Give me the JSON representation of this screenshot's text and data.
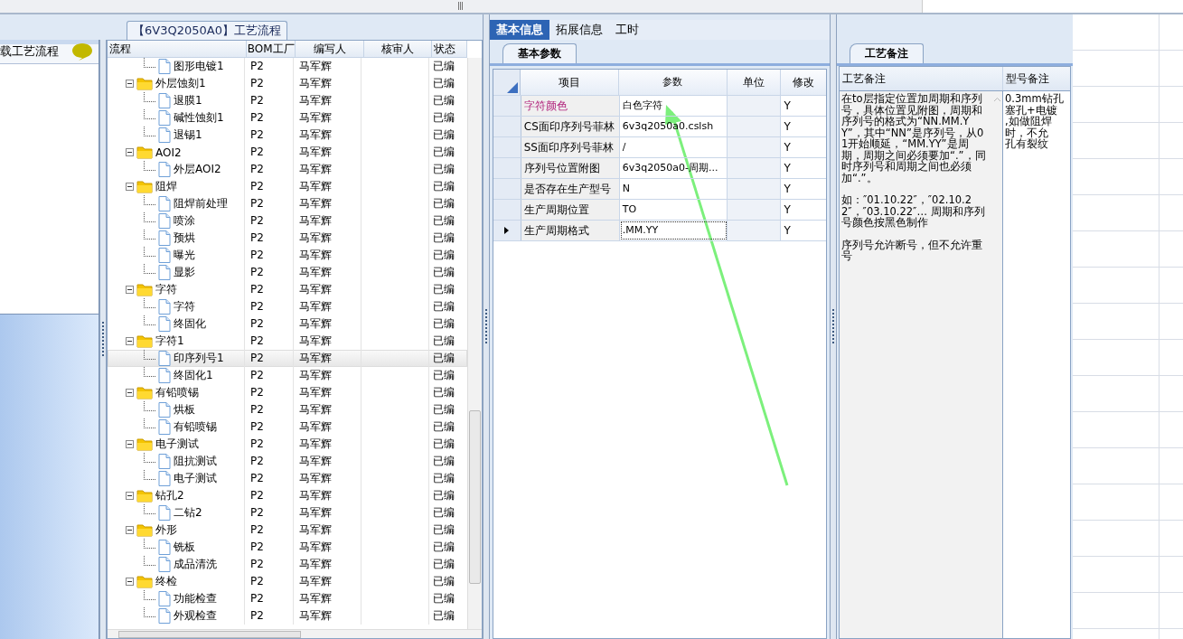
{
  "process_panel": {
    "title": "【6V3Q2050A0】工艺流程"
  },
  "sidebar": {
    "label": "载工艺流程"
  },
  "tree": {
    "columns": [
      "流程",
      "BOM工厂",
      "编写人",
      "核审人",
      "状态"
    ],
    "nodes": [
      {
        "kind": "file",
        "name": "图形电镀1",
        "bom": "P2",
        "author": "马军辉",
        "status": "已编",
        "selected": false
      },
      {
        "kind": "folder",
        "name": "外层蚀刻1",
        "bom": "P2",
        "author": "马军辉",
        "status": "已编",
        "selected": false,
        "children": [
          {
            "kind": "file",
            "name": "退膜1",
            "bom": "P2",
            "author": "马军辉",
            "status": "已编",
            "selected": false
          },
          {
            "kind": "file",
            "name": "碱性蚀刻1",
            "bom": "P2",
            "author": "马军辉",
            "status": "已编",
            "selected": false
          },
          {
            "kind": "file",
            "name": "退锡1",
            "bom": "P2",
            "author": "马军辉",
            "status": "已编",
            "selected": false
          }
        ]
      },
      {
        "kind": "folder",
        "name": "AOI2",
        "bom": "P2",
        "author": "马军辉",
        "status": "已编",
        "selected": false,
        "children": [
          {
            "kind": "file",
            "name": "外层AOI2",
            "bom": "P2",
            "author": "马军辉",
            "status": "已编",
            "selected": false
          }
        ]
      },
      {
        "kind": "folder",
        "name": "阻焊",
        "bom": "P2",
        "author": "马军辉",
        "status": "已编",
        "selected": false,
        "children": [
          {
            "kind": "file",
            "name": "阻焊前处理",
            "bom": "P2",
            "author": "马军辉",
            "status": "已编",
            "selected": false
          },
          {
            "kind": "file",
            "name": "喷涂",
            "bom": "P2",
            "author": "马军辉",
            "status": "已编",
            "selected": false
          },
          {
            "kind": "file",
            "name": "预烘",
            "bom": "P2",
            "author": "马军辉",
            "status": "已编",
            "selected": false
          },
          {
            "kind": "file",
            "name": "曝光",
            "bom": "P2",
            "author": "马军辉",
            "status": "已编",
            "selected": false
          },
          {
            "kind": "file",
            "name": "显影",
            "bom": "P2",
            "author": "马军辉",
            "status": "已编",
            "selected": false
          }
        ]
      },
      {
        "kind": "folder",
        "name": "字符",
        "bom": "P2",
        "author": "马军辉",
        "status": "已编",
        "selected": false,
        "children": [
          {
            "kind": "file",
            "name": "字符",
            "bom": "P2",
            "author": "马军辉",
            "status": "已编",
            "selected": false
          },
          {
            "kind": "file",
            "name": "终固化",
            "bom": "P2",
            "author": "马军辉",
            "status": "已编",
            "selected": false
          }
        ]
      },
      {
        "kind": "folder",
        "name": "字符1",
        "bom": "P2",
        "author": "马军辉",
        "status": "已编",
        "selected": false,
        "children": [
          {
            "kind": "file",
            "name": "印序列号1",
            "bom": "P2",
            "author": "马军辉",
            "status": "已编",
            "selected": true
          },
          {
            "kind": "file",
            "name": "终固化1",
            "bom": "P2",
            "author": "马军辉",
            "status": "已编",
            "selected": false
          }
        ]
      },
      {
        "kind": "folder",
        "name": "有铅喷锡",
        "bom": "P2",
        "author": "马军辉",
        "status": "已编",
        "selected": false,
        "children": [
          {
            "kind": "file",
            "name": "烘板",
            "bom": "P2",
            "author": "马军辉",
            "status": "已编",
            "selected": false
          },
          {
            "kind": "file",
            "name": "有铅喷锡",
            "bom": "P2",
            "author": "马军辉",
            "status": "已编",
            "selected": false
          }
        ]
      },
      {
        "kind": "folder",
        "name": "电子测试",
        "bom": "P2",
        "author": "马军辉",
        "status": "已编",
        "selected": false,
        "children": [
          {
            "kind": "file",
            "name": "阻抗测试",
            "bom": "P2",
            "author": "马军辉",
            "status": "已编",
            "selected": false
          },
          {
            "kind": "file",
            "name": "电子测试",
            "bom": "P2",
            "author": "马军辉",
            "status": "已编",
            "selected": false
          }
        ]
      },
      {
        "kind": "folder",
        "name": "钻孔2",
        "bom": "P2",
        "author": "马军辉",
        "status": "已编",
        "selected": false,
        "children": [
          {
            "kind": "file",
            "name": "二钻2",
            "bom": "P2",
            "author": "马军辉",
            "status": "已编",
            "selected": false
          }
        ]
      },
      {
        "kind": "folder",
        "name": "外形",
        "bom": "P2",
        "author": "马军辉",
        "status": "已编",
        "selected": false,
        "children": [
          {
            "kind": "file",
            "name": "铣板",
            "bom": "P2",
            "author": "马军辉",
            "status": "已编",
            "selected": false
          },
          {
            "kind": "file",
            "name": "成品清洗",
            "bom": "P2",
            "author": "马军辉",
            "status": "已编",
            "selected": false
          }
        ]
      },
      {
        "kind": "folder",
        "name": "终检",
        "bom": "P2",
        "author": "马军辉",
        "status": "已编",
        "selected": false,
        "children": [
          {
            "kind": "file",
            "name": "功能检查",
            "bom": "P2",
            "author": "马军辉",
            "status": "已编",
            "selected": false
          },
          {
            "kind": "file",
            "name": "外观检查",
            "bom": "P2",
            "author": "马军辉",
            "status": "已编",
            "selected": false
          }
        ]
      }
    ]
  },
  "tabs": [
    {
      "label": "基本信息",
      "selected": true
    },
    {
      "label": "拓展信息",
      "selected": false
    },
    {
      "label": "工时",
      "selected": false
    }
  ],
  "params": {
    "tab": "基本参数",
    "columns": [
      "项目",
      "参数",
      "单位",
      "修改"
    ],
    "rows": [
      {
        "item": "字符颜色",
        "value": "白色字符",
        "unit": "",
        "modify": "Y",
        "highlighted": true,
        "current": false
      },
      {
        "item": "CS面印序列号菲林",
        "value": "6v3q2050a0.cslsh",
        "unit": "",
        "modify": "Y",
        "highlighted": false,
        "current": false
      },
      {
        "item": "SS面印序列号菲林",
        "value": "/",
        "unit": "",
        "modify": "Y",
        "highlighted": false,
        "current": false
      },
      {
        "item": "序列号位置附图",
        "value": "6v3q2050a0-周期...",
        "unit": "",
        "modify": "Y",
        "highlighted": false,
        "current": false
      },
      {
        "item": "是否存在生产型号",
        "value": "N",
        "unit": "",
        "modify": "Y",
        "highlighted": false,
        "current": false
      },
      {
        "item": "生产周期位置",
        "value": "TO",
        "unit": "",
        "modify": "Y",
        "highlighted": false,
        "current": false
      },
      {
        "item": "生产周期格式",
        "value": ".MM.YY",
        "unit": "",
        "modify": "Y",
        "highlighted": false,
        "current": true
      }
    ]
  },
  "notes": {
    "tab": "工艺备注",
    "columns": [
      "工艺备注",
      "型号备注"
    ],
    "process_note": [
      "在to层指定位置加周期和序列号，具体位置见附图，周期和序列号的格式为“NN.MM.YY”，其中“NN”是序列号，从01开始顺延，“MM.YY”是周期，周期之间必须要加“.”，同时序列号和周期之间也必须加“.”。",
      "如：″01.10.22″，″02.10.22″，″03.10.22″… 周期和序列号颜色按黑色制作",
      "序列号允许断号，但不允许重号"
    ],
    "model_note": [
      "0.3mm钻孔",
      "塞孔+电镀",
      ",如做阻焊",
      "时，不允",
      "孔有裂纹"
    ]
  }
}
